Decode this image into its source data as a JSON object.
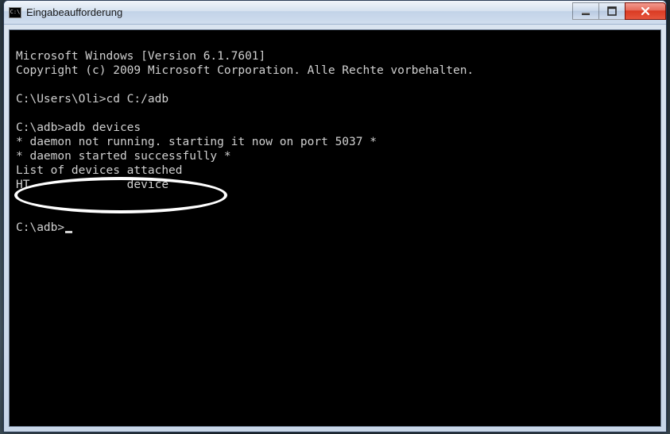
{
  "window": {
    "title": "Eingabeaufforderung",
    "icon_label": "C:\\"
  },
  "console": {
    "lines": [
      "Microsoft Windows [Version 6.1.7601]",
      "Copyright (c) 2009 Microsoft Corporation. Alle Rechte vorbehalten.",
      "",
      "C:\\Users\\Oli>cd C:/adb",
      "",
      "C:\\adb>adb devices",
      "* daemon not running. starting it now on port 5037 *",
      "* daemon started successfully *",
      "List of devices attached",
      "HT              device",
      "",
      "",
      "C:\\adb>"
    ],
    "prompt_cursor": "_"
  },
  "controls": {
    "minimize": "minimize",
    "maximize": "maximize",
    "close": "close"
  },
  "annotation": {
    "description": "hand-drawn-ellipse-highlight"
  }
}
